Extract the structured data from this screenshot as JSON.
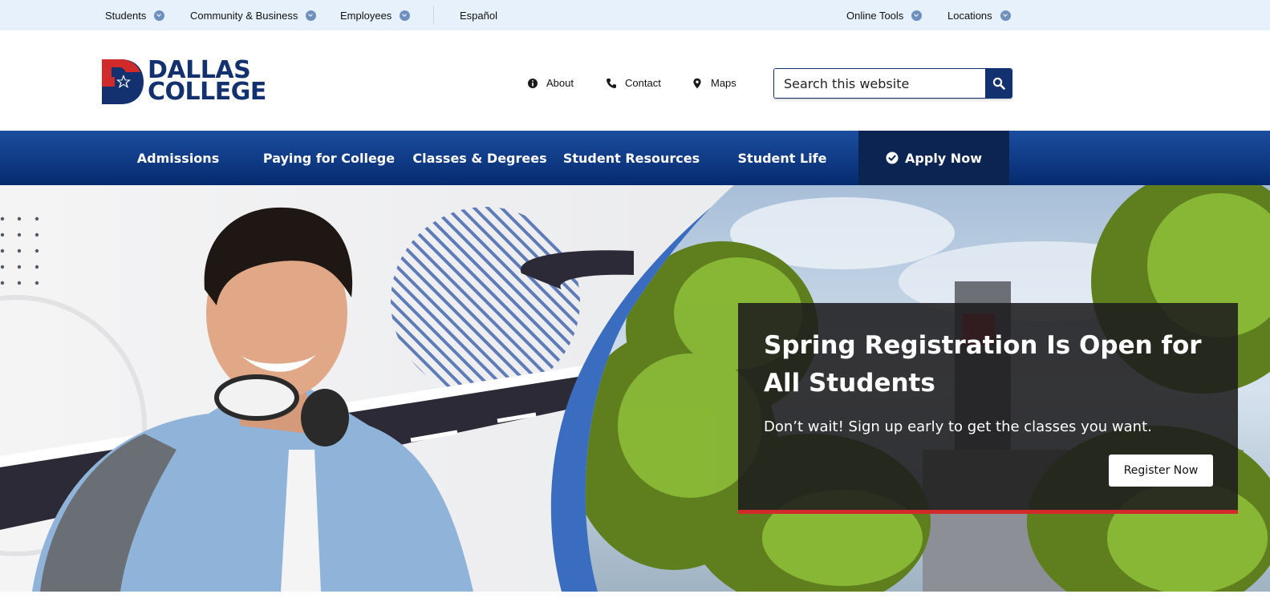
{
  "utility": {
    "left_items": [
      {
        "label": "Students"
      },
      {
        "label": "Community & Business"
      },
      {
        "label": "Employees"
      }
    ],
    "language": "Español",
    "right_items": [
      {
        "label": "Online Tools"
      },
      {
        "label": "Locations"
      }
    ]
  },
  "header": {
    "logo": {
      "line1": "DALLAS",
      "line2": "COLLEGE"
    },
    "links": [
      {
        "label": "About",
        "icon": "info-icon"
      },
      {
        "label": "Contact",
        "icon": "phone-icon"
      },
      {
        "label": "Maps",
        "icon": "map-pin-icon"
      }
    ],
    "search": {
      "placeholder": "Search this website",
      "value": ""
    }
  },
  "nav": {
    "items": [
      {
        "label": "Admissions"
      },
      {
        "label": "Paying for College"
      },
      {
        "label": "Classes & Degrees"
      },
      {
        "label": "Student Resources"
      },
      {
        "label": "Student Life"
      }
    ],
    "apply": {
      "label": "Apply Now",
      "icon": "check-circle-icon"
    }
  },
  "hero": {
    "title": "Spring Registration Is Open for All Students",
    "subtitle": "Don’t wait! Sign up early to get the classes you want.",
    "button": "Register Now"
  },
  "colors": {
    "brand_navy": "#12316e",
    "brand_red": "#d12a2a",
    "utility_bg": "#e6f1fc",
    "nav_blue": "#1c4da0",
    "apply_bg": "#0c2452"
  }
}
